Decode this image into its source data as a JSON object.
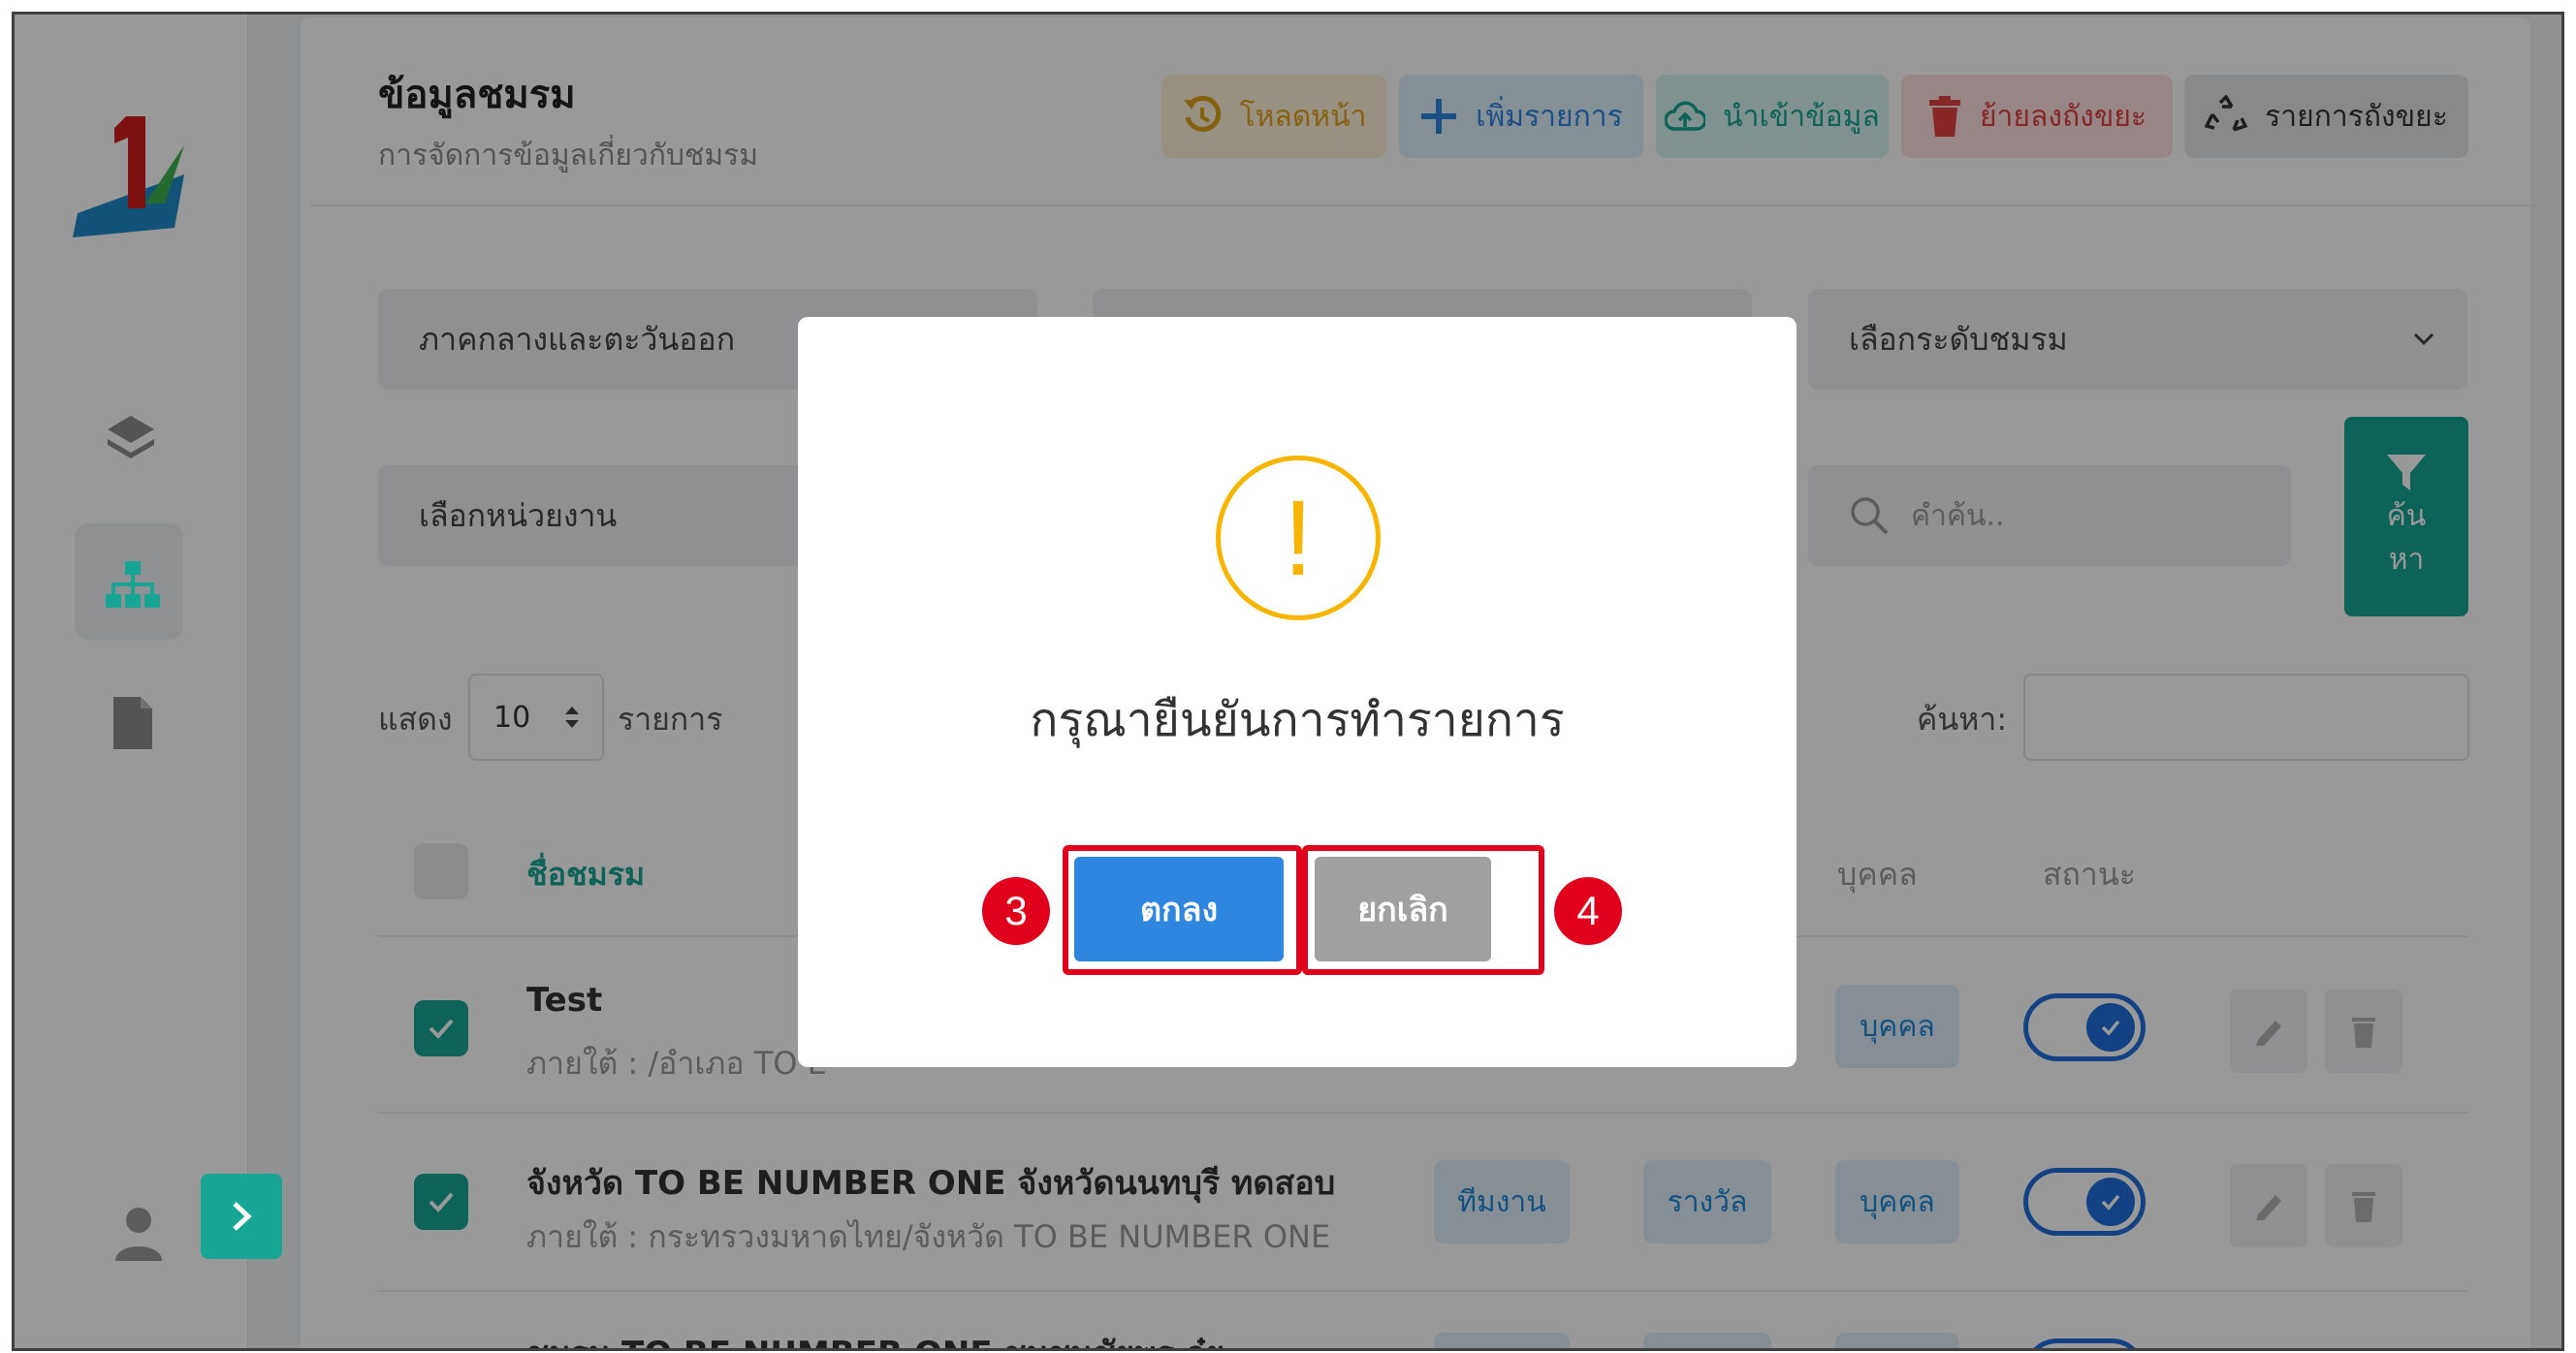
{
  "header": {
    "title": "ข้อมูลชมรม",
    "subtitle": "การจัดการข้อมูลเกี่ยวกับชมรม"
  },
  "toolbar": {
    "reload_label": "โหลดหน้า",
    "add_label": "เพิ่มรายการ",
    "import_label": "นำเข้าข้อมูล",
    "trash_label": "ย้ายลงถังขยะ",
    "trash_list_label": "รายการถังขยะ"
  },
  "filters": {
    "region": "ภาคกลางและตะวันออก",
    "level_placeholder": "เลือกระดับชมรม",
    "unit_placeholder": "เลือกหน่วยงาน",
    "keyword_placeholder": "คำค้น..",
    "search_button_top": "ค้น",
    "search_button_bottom": "หา"
  },
  "table_controls": {
    "show_label": "แสดง",
    "page_size": "10",
    "entries_label": "รายการ",
    "search_label": "ค้นหา:"
  },
  "table": {
    "col_name": "ชื่อชมรม",
    "col_person": "บุคคล",
    "col_status": "สถานะ",
    "rows": [
      {
        "name": "Test",
        "sub": "ภายใต้ : /อำเภอ TO E",
        "tag_person": "บุคคล"
      },
      {
        "name": "จังหวัด TO BE NUMBER ONE จังหวัดนนทบุรี ทดสอบ",
        "sub": "ภายใต้ : กระทรวงมหาดไทย/จังหวัด TO BE NUMBER ONE",
        "tag_team": "ทีมงาน",
        "tag_award": "รางวัล",
        "tag_person": "บุคคล"
      },
      {
        "name": "ชมรม TO BE NUMBER ONE ชุมชนชัยพร กุ๋ย"
      }
    ]
  },
  "modal": {
    "message": "กรุณายืนยันการทำรายการ",
    "confirm_label": "ตกลง",
    "cancel_label": "ยกเลิก",
    "step_confirm": "3",
    "step_cancel": "4"
  },
  "colors": {
    "brand_teal": "#17a693",
    "confirm_blue": "#2e86de",
    "cancel_gray": "#a0a0a0",
    "warning": "#f7b500",
    "annotation_red": "#e0001b"
  }
}
